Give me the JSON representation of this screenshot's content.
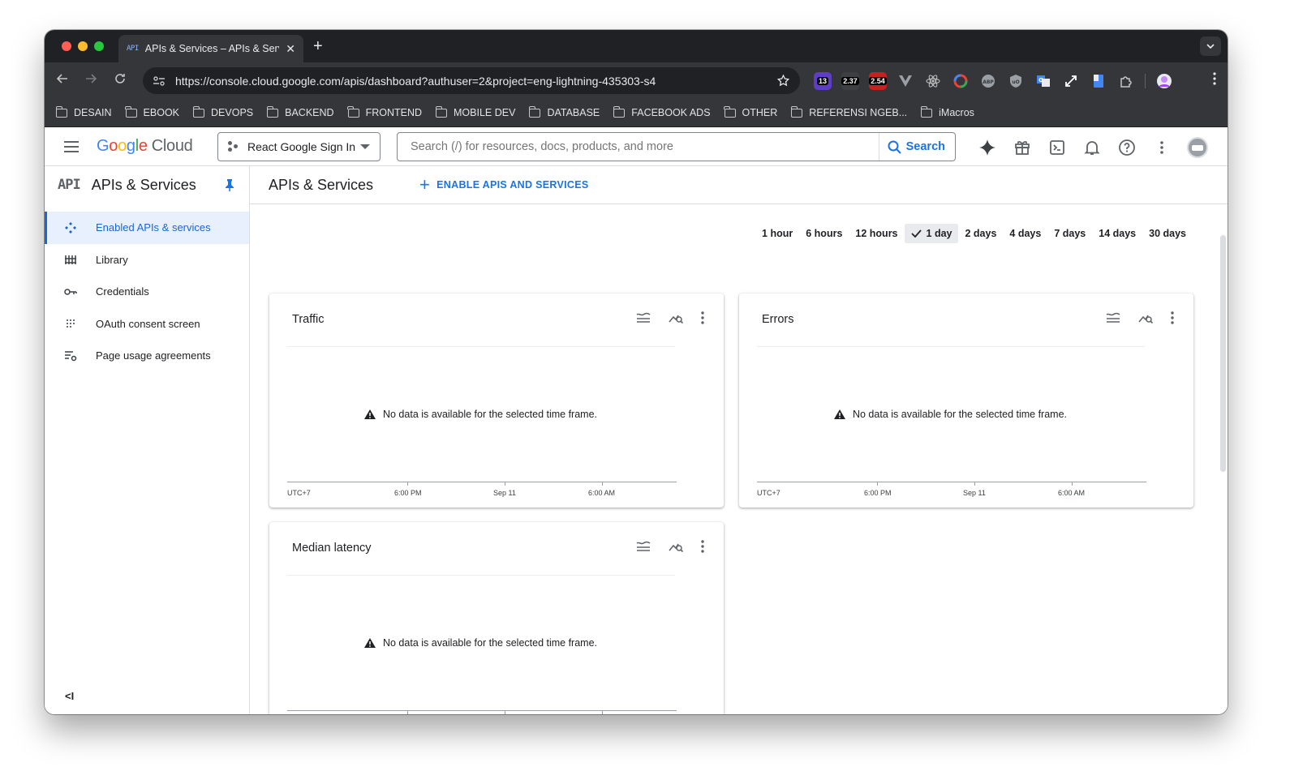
{
  "browser": {
    "tab_favicon": "API",
    "tab_title": "APIs & Services – APIs & Services",
    "tab_close": "✕",
    "new_tab": "+",
    "tab_menu": "⌄",
    "url": "https://console.cloud.google.com/apis/dashboard?authuser=2&project=eng-lightning-435303-s4",
    "extensions": [
      {
        "name": "ext-1",
        "badge": "13",
        "color": "#5f3dc4"
      },
      {
        "name": "ext-2",
        "badge": "2.37",
        "color": "#3c4043"
      },
      {
        "name": "ext-3",
        "badge": "2.54",
        "color": "#c5221f"
      },
      {
        "name": "vue-devtools",
        "color": "#9aa0a6"
      },
      {
        "name": "react-devtools",
        "color": "#61dafb"
      },
      {
        "name": "colorzilla",
        "color": "#e8eaed"
      },
      {
        "name": "adblock",
        "color": "#9aa0a6"
      },
      {
        "name": "ublock",
        "color": "#9aa0a6"
      },
      {
        "name": "translate",
        "color": "#4285f4"
      },
      {
        "name": "expand",
        "color": "#ffffff"
      },
      {
        "name": "docs",
        "color": "#4285f4"
      },
      {
        "name": "puzzle",
        "color": "#c4c7c5"
      }
    ]
  },
  "bookmarks": [
    "DESAIN",
    "EBOOK",
    "DEVOPS",
    "BACKEND",
    "FRONTEND",
    "MOBILE DEV",
    "DATABASE",
    "FACEBOOK ADS",
    "OTHER",
    "REFERENSI NGEB...",
    "iMacros"
  ],
  "header": {
    "logo_google": "Google",
    "logo_cloud": "Cloud",
    "project": "React Google Sign In",
    "search_placeholder": "Search (/) for resources, docs, products, and more",
    "search_button": "Search"
  },
  "sidebar": {
    "logo": "API",
    "title": "APIs & Services",
    "items": [
      {
        "label": "Enabled APIs & services",
        "icon": "api-hub-icon",
        "active": true
      },
      {
        "label": "Library",
        "icon": "library-icon",
        "active": false
      },
      {
        "label": "Credentials",
        "icon": "key-icon",
        "active": false
      },
      {
        "label": "OAuth consent screen",
        "icon": "dots-grid-icon",
        "active": false
      },
      {
        "label": "Page usage agreements",
        "icon": "list-settings-icon",
        "active": false
      }
    ],
    "collapse": "<I"
  },
  "main": {
    "title": "APIs & Services",
    "enable_button": "ENABLE APIS AND SERVICES",
    "time_ranges": [
      "1 hour",
      "6 hours",
      "12 hours",
      "1 day",
      "2 days",
      "4 days",
      "7 days",
      "14 days",
      "30 days"
    ],
    "selected_range": "1 day",
    "no_data_message": "No data is available for the selected time frame.",
    "axis_labels": [
      "UTC+7",
      "6:00 PM",
      "Sep 11",
      "6:00 AM"
    ],
    "cards": [
      {
        "title": "Traffic"
      },
      {
        "title": "Errors"
      },
      {
        "title": "Median latency"
      }
    ]
  }
}
